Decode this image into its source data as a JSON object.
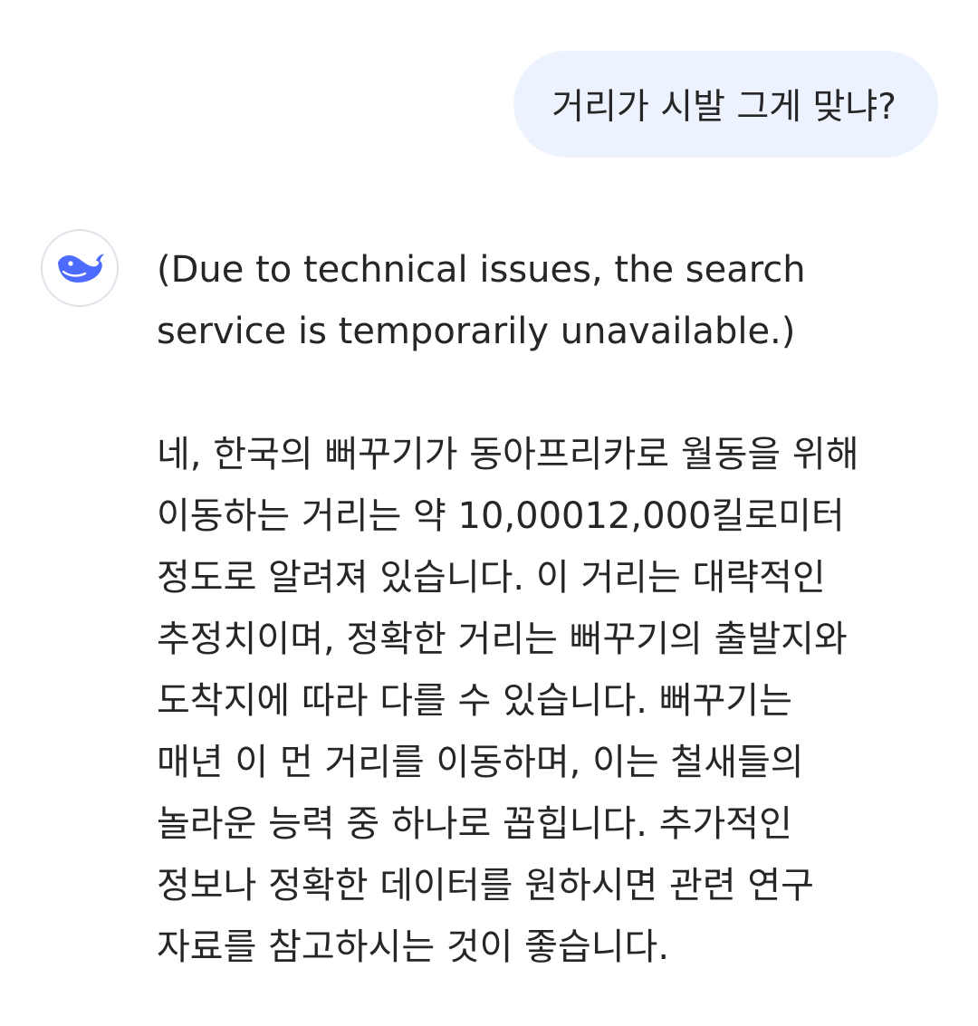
{
  "user_message": {
    "text": "거리가 시발 그게 맞냐?"
  },
  "assistant_message": {
    "avatar_icon": "deepseek-whale-icon",
    "notice": "(Due to technical issues, the search\nservice is temporarily unavailable.)",
    "body": "네, 한국의 뻐꾸기가 동아프리카로 월동을 위해\n이동하는 거리는 약 10,00012,000킬로미터\n정도로 알려져 있습니다. 이 거리는 대략적인\n추정치이며, 정확한 거리는 뻐꾸기의 출발지와\n도착지에 따라 다를 수 있습니다. 뻐꾸기는\n매년 이 먼 거리를 이동하며, 이는 철새들의\n놀라운 능력 중 하나로 꼽힙니다. 추가적인\n정보나 정확한 데이터를 원하시면 관련 연구\n자료를 참고하시는 것이 좋습니다."
  },
  "colors": {
    "user_bubble": "#edf3fe",
    "avatar_accent": "#4d6bfe",
    "text": "#262626"
  }
}
